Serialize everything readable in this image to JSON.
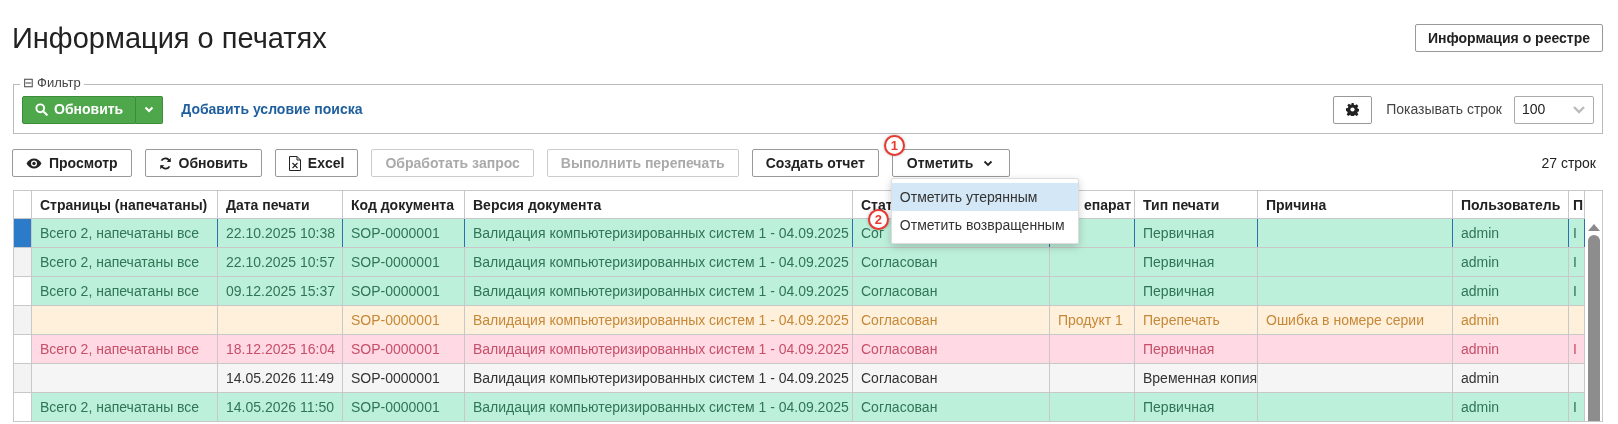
{
  "title": "Информация о печатях",
  "registry_button": "Информация о реестре",
  "filter": {
    "legend": "Фильтр",
    "collapse_glyph": "⊟",
    "refresh_button": "Обновить",
    "add_condition_link": "Добавить условие поиска",
    "rows_label": "Показывать строк",
    "rows_select": {
      "value": "100"
    }
  },
  "toolbar": {
    "buttons": [
      {
        "label": "Просмотр",
        "disabled": false
      },
      {
        "label": "Обновить",
        "disabled": false
      },
      {
        "label": "Excel",
        "disabled": false
      },
      {
        "label": "Обработать запрос",
        "disabled": true
      },
      {
        "label": "Выполнить перепечать",
        "disabled": true
      },
      {
        "label": "Создать отчет",
        "disabled": false
      }
    ],
    "mark_menu": {
      "label": "Отметить",
      "items": [
        {
          "label": "Отметить утерянным",
          "selected": true
        },
        {
          "label": "Отметить возвращенным",
          "selected": false
        }
      ]
    }
  },
  "row_count": "27 строк",
  "callouts": [
    "1",
    "2"
  ],
  "table": {
    "columns": [
      "Страницы (напечатаны)",
      "Дата печати",
      "Код документа",
      "Версия документа",
      "Стат",
      "епарат",
      "Тип печати",
      "Причина",
      "Пользователь",
      "П"
    ],
    "rows": [
      {
        "kind": "printed",
        "selected": true,
        "cells": [
          "Всего 2, напечатаны все",
          "22.10.2025 10:38",
          "SOP-0000001",
          "Валидация компьютеризированных систем 1 - 04.09.2025",
          "Сог",
          "",
          "Первичная",
          "",
          "admin",
          "I"
        ]
      },
      {
        "kind": "printed",
        "selected": false,
        "cells": [
          "Всего 2, напечатаны все",
          "22.10.2025 10:57",
          "SOP-0000001",
          "Валидация компьютеризированных систем 1 - 04.09.2025",
          "Согласован",
          "",
          "Первичная",
          "",
          "admin",
          "I"
        ]
      },
      {
        "kind": "printed",
        "selected": false,
        "cells": [
          "Всего 2, напечатаны все",
          "09.12.2025 15:37",
          "SOP-0000001",
          "Валидация компьютеризированных систем 1 - 04.09.2025",
          "Согласован",
          "",
          "Первичная",
          "",
          "admin",
          "I"
        ]
      },
      {
        "kind": "reprint",
        "selected": false,
        "cells": [
          "",
          "",
          "SOP-0000001",
          "Валидация компьютеризированных систем 1 - 04.09.2025",
          "Согласован",
          "Продукт 1",
          "Перепечать",
          "Ошибка в номере серии",
          "admin",
          ""
        ]
      },
      {
        "kind": "flagged",
        "selected": false,
        "cells": [
          "Всего 2, напечатаны все",
          "18.12.2025 16:04",
          "SOP-0000001",
          "Валидация компьютеризированных систем 1 - 04.09.2025",
          "Согласован",
          "",
          "Первичная",
          "",
          "admin",
          "I"
        ]
      },
      {
        "kind": "copy",
        "selected": false,
        "cells": [
          "",
          "14.05.2026 11:49",
          "SOP-0000001",
          "Валидация компьютеризированных систем 1 - 04.09.2025",
          "Согласован",
          "",
          "Временная копия",
          "",
          "admin",
          ""
        ]
      },
      {
        "kind": "printed",
        "selected": false,
        "cells": [
          "Всего 2, напечатаны все",
          "14.05.2026 11:50",
          "SOP-0000001",
          "Валидация компьютеризированных систем 1 - 04.09.2025",
          "Согласован",
          "",
          "Первичная",
          "",
          "admin",
          "I"
        ]
      }
    ]
  }
}
